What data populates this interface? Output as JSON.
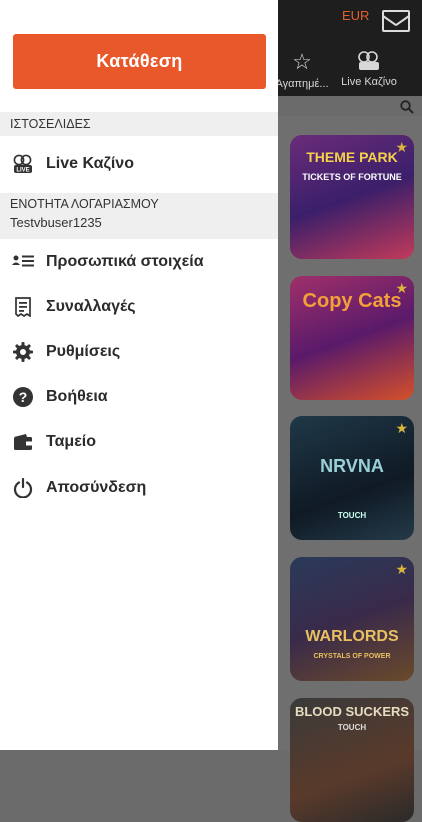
{
  "header": {
    "currency": "EUR",
    "tabs": [
      {
        "label": "Αγαπημέ..."
      },
      {
        "label": "Live Καζίνο"
      }
    ]
  },
  "drawer": {
    "deposit_label": "Κατάθεση",
    "websites_header": "ΙΣΤΟΣΕΛΙΔΕΣ",
    "live_casino_label": "Live Καζίνο",
    "account_header": "ΕΝΟΤΗΤΑ ΛΟΓΑΡΙΑΣΜΟΥ",
    "username": "Testvbuser1235",
    "menu": [
      {
        "label": "Προσωπικά στοιχεία",
        "icon": "personal-details-icon"
      },
      {
        "label": "Συναλλαγές",
        "icon": "receipt-icon"
      },
      {
        "label": "Ρυθμίσεις",
        "icon": "gear-icon"
      },
      {
        "label": "Βοήθεια",
        "icon": "help-icon"
      },
      {
        "label": "Ταμείο",
        "icon": "wallet-icon"
      },
      {
        "label": "Αποσύνδεση",
        "icon": "power-icon"
      }
    ]
  },
  "games": [
    {
      "title": "THEME PARK",
      "subtitle": "TICKETS OF FORTUNE"
    },
    {
      "title": "Copy Cats",
      "subtitle": ""
    },
    {
      "title": "NRVNA",
      "subtitle": "TOUCH"
    },
    {
      "title": "WARLORDS",
      "subtitle": "CRYSTALS OF POWER"
    },
    {
      "title": "BLOOD SUCKERS",
      "subtitle": "TOUCH"
    }
  ],
  "colors": {
    "accent": "#e8582a",
    "currency": "#e0602a"
  }
}
